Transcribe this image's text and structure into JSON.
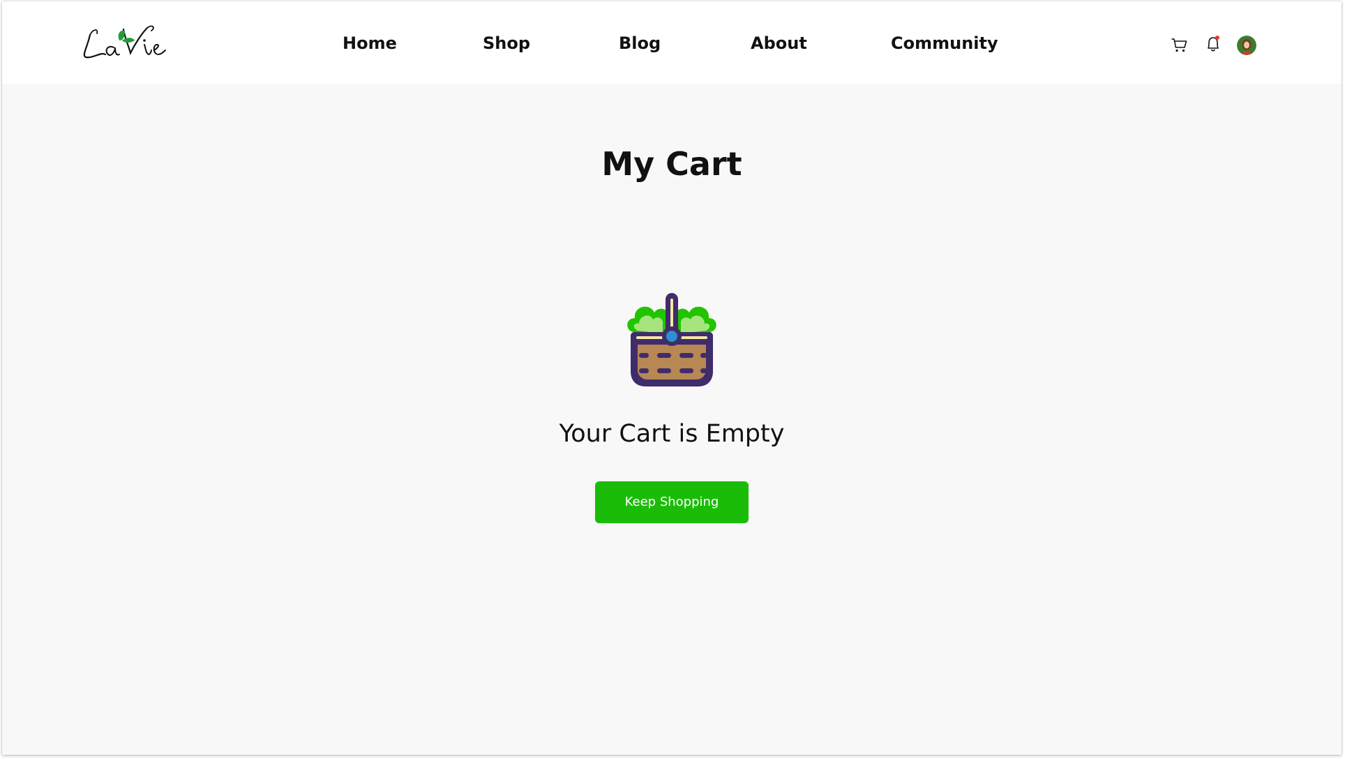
{
  "brand": {
    "logo_text": "La Vie",
    "accent_color": "#1abc08"
  },
  "nav": {
    "items": [
      {
        "label": "Home"
      },
      {
        "label": "Shop"
      },
      {
        "label": "Blog"
      },
      {
        "label": "About"
      },
      {
        "label": "Community"
      }
    ]
  },
  "header_icons": {
    "cart": "cart-icon",
    "notifications": "bell-icon",
    "notification_dot_color": "#e53935",
    "avatar": "avatar"
  },
  "main": {
    "title": "My Cart",
    "illustration": "basket-icon",
    "empty_message": "Your Cart is Empty",
    "button_label": "Keep Shopping"
  }
}
